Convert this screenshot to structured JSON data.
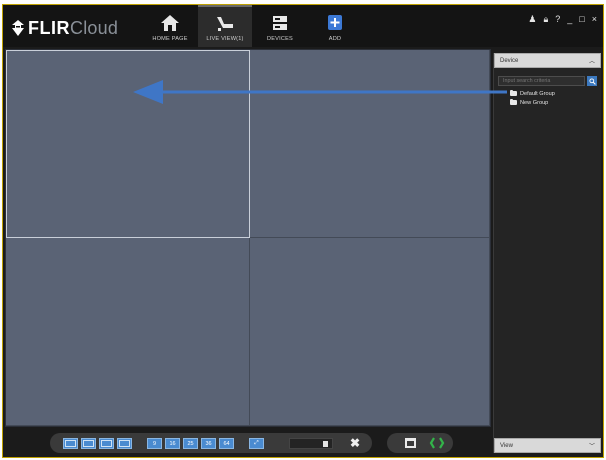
{
  "app": {
    "logo": {
      "primary": "FLIR",
      "secondary": "Cloud"
    }
  },
  "nav": [
    {
      "label": "HOME PAGE",
      "icon": "home-icon",
      "active": false
    },
    {
      "label": "LIVE VIEW(1)",
      "icon": "camera-icon",
      "active": true
    },
    {
      "label": "DEVICES",
      "icon": "devices-icon",
      "active": false
    },
    {
      "label": "ADD",
      "icon": "add-icon",
      "active": false
    }
  ],
  "window_controls": [
    {
      "icon": "user-icon",
      "glyph": "♟"
    },
    {
      "icon": "lock-icon",
      "glyph": "🔒︎"
    },
    {
      "icon": "help-icon",
      "glyph": "?"
    },
    {
      "icon": "minimize-icon",
      "glyph": "_"
    },
    {
      "icon": "maximize-icon",
      "glyph": "□"
    },
    {
      "icon": "close-icon",
      "glyph": "×"
    }
  ],
  "sidebar": {
    "header": "Device",
    "search_placeholder": "Input search criteria",
    "tree": [
      "Default Group",
      "New Group"
    ],
    "footer": "View"
  },
  "toolbar": {
    "layout_buttons": [
      "",
      "",
      "",
      "",
      "9",
      "16",
      "25",
      "36",
      "64"
    ]
  },
  "colors": {
    "accent": "#4a8bd0",
    "video_bg": "#5a6375",
    "arrow": "#3f76c6",
    "record": "#33b44a"
  }
}
